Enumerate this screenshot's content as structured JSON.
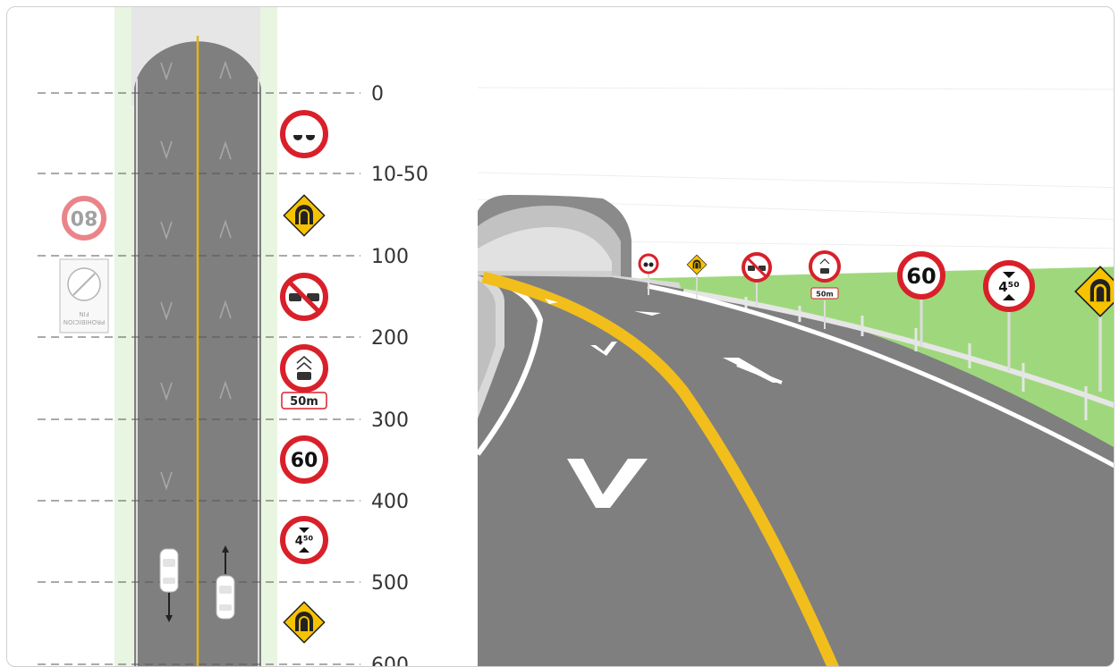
{
  "distance_labels": [
    "0",
    "10-50",
    "100",
    "200",
    "300",
    "400",
    "500",
    "600"
  ],
  "plan_signs": {
    "speed_limit": "60",
    "height_limit": "4⁵⁰",
    "plate": "50m",
    "end_restriction": {
      "speed": "80",
      "line1": "PROHIBICION",
      "line2": "FIN"
    }
  },
  "perspective_signs": {
    "plate": "50m",
    "speed_limit": "60",
    "height_limit": "4⁵⁰"
  },
  "colors": {
    "sign_red": "#d9202a",
    "warning_yellow": "#f7c200",
    "center_line": "#f2be1c",
    "road": "#7f7f7f",
    "grass": "#9fd87c"
  }
}
